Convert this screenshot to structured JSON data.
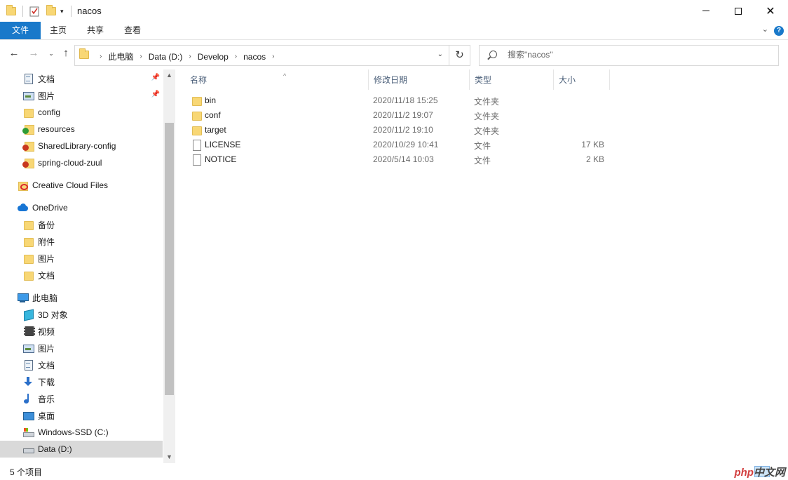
{
  "window": {
    "title": "nacos",
    "controls": {
      "minimize": "—",
      "maximize": "□",
      "close": "✕"
    }
  },
  "ribbon": {
    "tabs": [
      "文件",
      "主页",
      "共享",
      "查看"
    ],
    "help": "?"
  },
  "address": {
    "crumbs": [
      "此电脑",
      "Data (D:)",
      "Develop",
      "nacos"
    ],
    "search_placeholder": "搜索\"nacos\""
  },
  "nav": {
    "items": [
      {
        "label": "文档",
        "icon": "document-icon",
        "pinned": true
      },
      {
        "label": "图片",
        "icon": "picture-icon",
        "pinned": true
      },
      {
        "label": "config",
        "icon": "folder-icon"
      },
      {
        "label": "resources",
        "icon": "folder-sync-ok-icon"
      },
      {
        "label": "SharedLibrary-config",
        "icon": "folder-sync-error-icon"
      },
      {
        "label": "spring-cloud-zuul",
        "icon": "folder-sync-error-icon"
      },
      {
        "label": "Creative Cloud Files",
        "icon": "creative-cloud-icon"
      },
      {
        "label": "OneDrive",
        "icon": "onedrive-icon"
      },
      {
        "label": "备份",
        "icon": "folder-icon"
      },
      {
        "label": "附件",
        "icon": "folder-icon"
      },
      {
        "label": "图片",
        "icon": "folder-icon"
      },
      {
        "label": "文档",
        "icon": "folder-icon"
      },
      {
        "label": "此电脑",
        "icon": "this-pc-icon"
      },
      {
        "label": "3D 对象",
        "icon": "3d-objects-icon"
      },
      {
        "label": "视频",
        "icon": "video-icon"
      },
      {
        "label": "图片",
        "icon": "picture-icon"
      },
      {
        "label": "文档",
        "icon": "document-icon"
      },
      {
        "label": "下载",
        "icon": "download-icon"
      },
      {
        "label": "音乐",
        "icon": "music-icon"
      },
      {
        "label": "桌面",
        "icon": "desktop-icon"
      },
      {
        "label": "Windows-SSD (C:)",
        "icon": "windows-drive-icon"
      },
      {
        "label": "Data (D:)",
        "icon": "drive-icon",
        "selected": true
      }
    ]
  },
  "files": {
    "columns": [
      "名称",
      "修改日期",
      "类型",
      "大小"
    ],
    "rows": [
      {
        "name": "bin",
        "date": "2020/11/18 15:25",
        "type": "文件夹",
        "size": "",
        "icon": "folder-icon"
      },
      {
        "name": "conf",
        "date": "2020/11/2 19:07",
        "type": "文件夹",
        "size": "",
        "icon": "folder-icon"
      },
      {
        "name": "target",
        "date": "2020/11/2 19:10",
        "type": "文件夹",
        "size": "",
        "icon": "folder-icon"
      },
      {
        "name": "LICENSE",
        "date": "2020/10/29 10:41",
        "type": "文件",
        "size": "17 KB",
        "icon": "file-icon"
      },
      {
        "name": "NOTICE",
        "date": "2020/5/14 10:03",
        "type": "文件",
        "size": "2 KB",
        "icon": "file-icon"
      }
    ]
  },
  "status": {
    "item_count": "5 个项目",
    "watermark_php": "php",
    "watermark_cn": "中文网"
  }
}
